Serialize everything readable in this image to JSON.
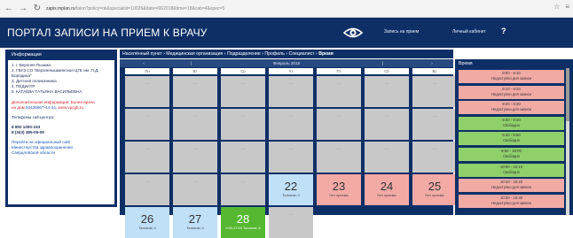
{
  "browser": {
    "url_host": "zapis.mplan.ru",
    "url_rest": "/talon?policy=ok&specialist=10026&date=06/2018&time=18&cab=4&spec=5"
  },
  "header": {
    "title": "ПОРТАЛ ЗАПИСИ НА ПРИЕМ К ВРАЧУ",
    "link1": "Запись на прием",
    "link2": "Личный кабинет",
    "help": "?"
  },
  "info": {
    "heading": "Информация",
    "lines": [
      "1. г. Верхняя Пышма",
      "2. ГБУЗ СО \"Верхнепышминская ЦГБ им. П.Д.",
      "Бородина\"",
      "3. Детская поликлиника",
      "4. ПЕДИАТР",
      "5. КАТАЕВА ТАТЬЯНА ВАСИЛЬЕВНА"
    ],
    "extra_line1": "Дополнительная информация: Более врача",
    "extra_line2_pre": "на дом ",
    "extra_phone": "83436867-44-44",
    "extra_line2_post": ", www.vpcgb.ru",
    "phones_label": "Телефоны call-центра:",
    "phone1": "8 800 1000-153",
    "phone2": "8 (343) 385-05-09",
    "portal_link1": "Перейти на официальный сайт",
    "portal_link2": "Министерства здравоохранения",
    "portal_link3": "Свердловской области"
  },
  "breadcrumb": {
    "items": [
      "Населённый пункт",
      "Медицинская организация",
      "Подразделение",
      "Профиль",
      "Специалист"
    ],
    "separator": "›",
    "current": "Время"
  },
  "calendar": {
    "prev": "‹",
    "next": "›",
    "month": "Февраль 2018",
    "days_of_week": [
      "Пн",
      "Вт",
      "Ср",
      "Чт",
      "Пт",
      "Сб",
      "Вс"
    ],
    "dash": "—",
    "dated_cells": [
      {
        "row": 3,
        "col": 3,
        "day": "22",
        "note": "Талонов: 0",
        "style": "blue"
      },
      {
        "row": 3,
        "col": 4,
        "day": "23",
        "note": "Нет приема",
        "style": "pink"
      },
      {
        "row": 3,
        "col": 5,
        "day": "24",
        "note": "Нет приема",
        "style": "pink"
      },
      {
        "row": 3,
        "col": 6,
        "day": "25",
        "note": "Нет приема",
        "style": "pink"
      },
      {
        "row": 4,
        "col": 0,
        "day": "26",
        "note": "Талонов: 0",
        "style": "blue"
      },
      {
        "row": 4,
        "col": 1,
        "day": "27",
        "note": "Талонов: 0",
        "style": "blue"
      },
      {
        "row": 4,
        "col": 2,
        "day": "28",
        "note": "9:00-17:00 Талонов: 8",
        "style": "green"
      }
    ]
  },
  "times": {
    "heading": "Время",
    "slots": [
      {
        "time": "9:00 - 9:10",
        "status": "Недоступно для записи",
        "style": "busy"
      },
      {
        "time": "9:10 - 9:20",
        "status": "Недоступно для записи",
        "style": "busy"
      },
      {
        "time": "9:20 - 9:30",
        "status": "Недоступно для записи",
        "style": "busy"
      },
      {
        "time": "9:30 - 9:40",
        "status": "Свободно",
        "style": "free"
      },
      {
        "time": "9:40 - 9:50",
        "status": "Свободно",
        "style": "free"
      },
      {
        "time": "9:50 - 10:00",
        "status": "Свободно",
        "style": "free"
      },
      {
        "time": "10:00 - 10:10",
        "status": "Свободно",
        "style": "free"
      },
      {
        "time": "10:10 - 10:20",
        "status": "Недоступно для записи",
        "style": "busy"
      },
      {
        "time": "10:20 - 10:30",
        "status": "Недоступно для записи",
        "style": "busy"
      }
    ]
  },
  "colors": {
    "header": "#0e2f66",
    "busy": "#f2aaa5",
    "free": "#8fd06a",
    "selected_day": "#55b830"
  }
}
